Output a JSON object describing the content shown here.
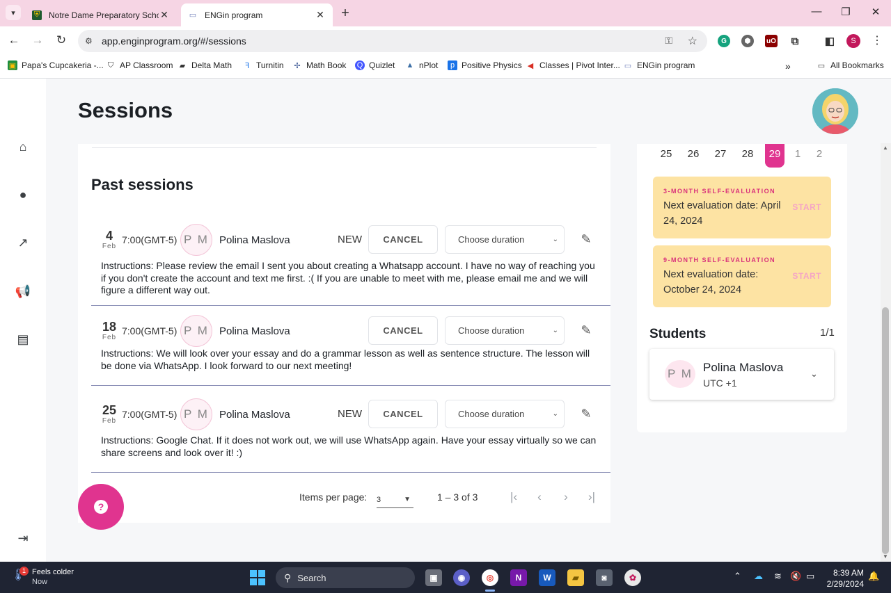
{
  "browser": {
    "tabs": [
      {
        "title": "Notre Dame Preparatory Schoo",
        "active": false
      },
      {
        "title": "ENGin program",
        "active": true
      }
    ],
    "url": "app.enginprogram.org/#/sessions",
    "profile_initial": "S",
    "bookmarks": [
      {
        "label": "Papa's Cupcakeria -...",
        "icon": "classroom-icon"
      },
      {
        "label": "AP Classroom",
        "icon": "ap-icon"
      },
      {
        "label": "Delta Math",
        "icon": "deltamath-icon"
      },
      {
        "label": "Turnitin",
        "icon": "turnitin-icon"
      },
      {
        "label": "Math Book",
        "icon": "mathbook-icon"
      },
      {
        "label": "Quizlet",
        "icon": "quizlet-icon"
      },
      {
        "label": "nPlot",
        "icon": "nplot-icon"
      },
      {
        "label": "Positive Physics",
        "icon": "physics-icon"
      },
      {
        "label": "Classes | Pivot Inter...",
        "icon": "pivot-icon"
      },
      {
        "label": "ENGin program",
        "icon": "engin-icon"
      }
    ],
    "all_bookmarks": "All Bookmarks"
  },
  "page": {
    "title": "Sessions",
    "past_title": "Past sessions"
  },
  "sessions": [
    {
      "day": "4",
      "month": "Feb",
      "time": "7:00(GMT-5)",
      "initials": "P M",
      "name": "Polina Maslova",
      "status": "NEW",
      "cancel": "CANCEL",
      "duration_placeholder": "Choose duration",
      "instructions": "Instructions: Please review the email I sent you about creating a Whatsapp account. I have no way of reaching you if you don't create the account and text me first. :( If you are unable to meet with me, please email me and we will figure a different way out."
    },
    {
      "day": "18",
      "month": "Feb",
      "time": "7:00(GMT-5)",
      "initials": "P M",
      "name": "Polina Maslova",
      "status": "",
      "cancel": "CANCEL",
      "duration_placeholder": "Choose duration",
      "instructions": "Instructions: We will look over your essay and do a grammar lesson as well as sentence structure. The lesson will be done via WhatsApp. I look forward to our next meeting!"
    },
    {
      "day": "25",
      "month": "Feb",
      "time": "7:00(GMT-5)",
      "initials": "P M",
      "name": "Polina Maslova",
      "status": "NEW",
      "cancel": "CANCEL",
      "duration_placeholder": "Choose duration",
      "instructions": "Instructions: Google Chat. If it does not work out, we will use WhatsApp again. Have your essay virtually so we can share screens and look over it! :)"
    }
  ],
  "paginator": {
    "label": "Items per page:",
    "per_page": "3",
    "range": "1 – 3 of 3"
  },
  "calendar": {
    "days": [
      "25",
      "26",
      "27",
      "28",
      "29",
      "1",
      "2"
    ],
    "selected": "29"
  },
  "evaluations": [
    {
      "label": "3-MONTH SELF-EVALUATION",
      "text": "Next evaluation date: April 24, 2024",
      "action": "START"
    },
    {
      "label": "9-MONTH SELF-EVALUATION",
      "text": "Next evaluation date: October 24, 2024",
      "action": "START"
    }
  ],
  "students": {
    "title": "Students",
    "count": "1/1",
    "items": [
      {
        "initials": "P M",
        "name": "Polina Maslova",
        "timezone": "UTC +1"
      }
    ]
  },
  "taskbar": {
    "weather_badge": "1",
    "weather_title": "Feels colder",
    "weather_sub": "Now",
    "search_placeholder": "Search",
    "time": "8:39 AM",
    "date": "2/29/2024"
  },
  "colors": {
    "accent": "#e0348f",
    "eval_bg": "#fde3a3",
    "tab_bar": "#f6d5e4"
  }
}
